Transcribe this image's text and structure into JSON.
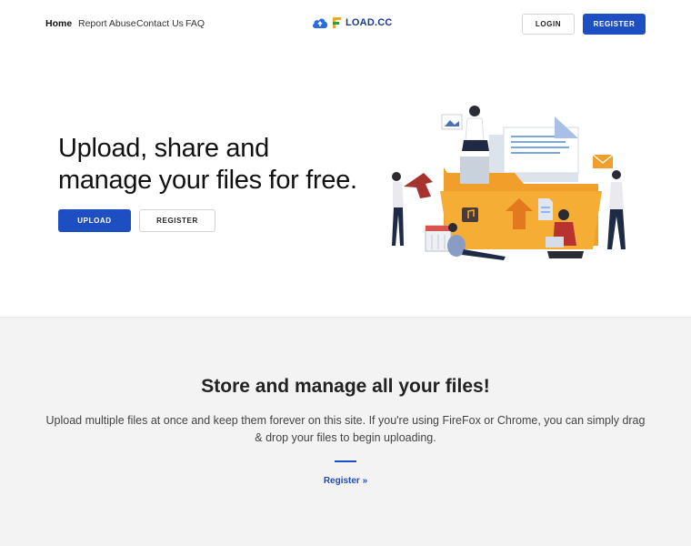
{
  "nav": {
    "links": [
      {
        "label": "Home"
      },
      {
        "label": "Report Abuse"
      },
      {
        "label": "Contact Us"
      },
      {
        "label": "FAQ"
      }
    ],
    "logo_text": "LOAD.CC",
    "login_label": "LOGIN",
    "register_label": "REGISTER"
  },
  "hero": {
    "title": "Upload, share and manage your files for free.",
    "upload_label": "UPLOAD",
    "register_label": "REGISTER"
  },
  "features": {
    "title": "Store and manage all your files!",
    "text": "Upload multiple files at once and keep them forever on this site. If you're using FireFox or Chrome, you can simply drag & drop your files to begin uploading.",
    "register_link": "Register »"
  },
  "colors": {
    "accent": "#1e4fc2",
    "folder": "#f5a623"
  }
}
